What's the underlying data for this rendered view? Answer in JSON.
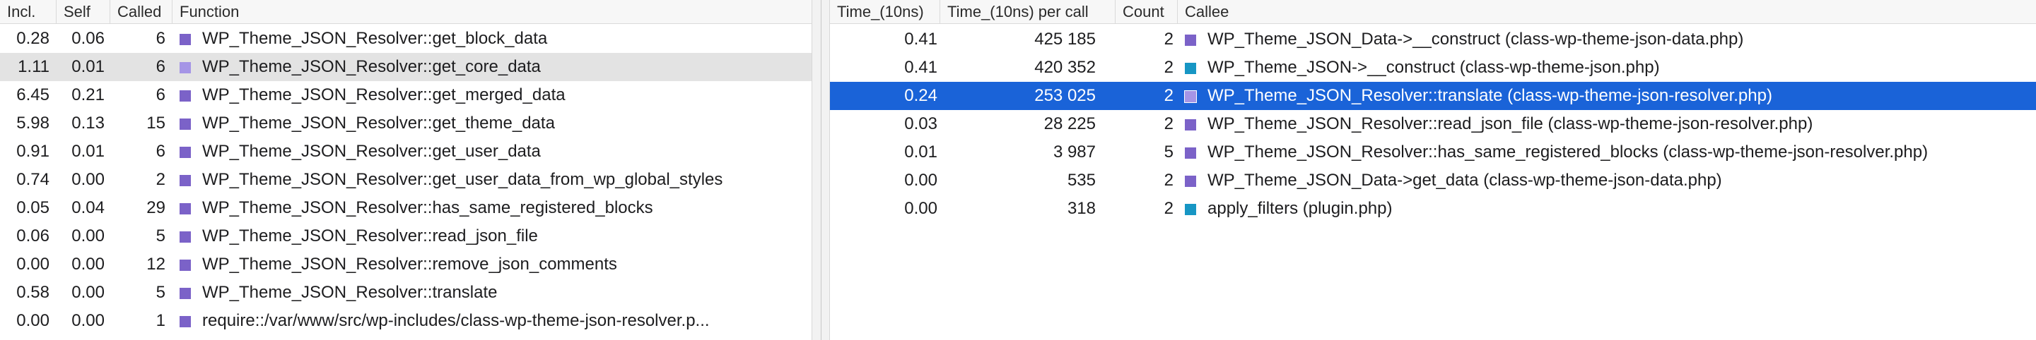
{
  "colors": {
    "purple": "#7b62c8",
    "light_purple": "#a595e6",
    "teal": "#1796c4",
    "selected_row": "#1a63d8",
    "gray_row": "#e3e3e3"
  },
  "left": {
    "headers": {
      "incl": "Incl.",
      "self": "Self",
      "called": "Called",
      "function": "Function"
    },
    "rows": [
      {
        "incl": "0.28",
        "self": "0.06",
        "called": "6",
        "function": "WP_Theme_JSON_Resolver::get_block_data",
        "icon": "purple"
      },
      {
        "incl": "1.11",
        "self": "0.01",
        "called": "6",
        "function": "WP_Theme_JSON_Resolver::get_core_data",
        "icon": "light_purple",
        "highlight": "gray"
      },
      {
        "incl": "6.45",
        "self": "0.21",
        "called": "6",
        "function": "WP_Theme_JSON_Resolver::get_merged_data",
        "icon": "purple"
      },
      {
        "incl": "5.98",
        "self": "0.13",
        "called": "15",
        "function": "WP_Theme_JSON_Resolver::get_theme_data",
        "icon": "purple"
      },
      {
        "incl": "0.91",
        "self": "0.01",
        "called": "6",
        "function": "WP_Theme_JSON_Resolver::get_user_data",
        "icon": "purple"
      },
      {
        "incl": "0.74",
        "self": "0.00",
        "called": "2",
        "function": "WP_Theme_JSON_Resolver::get_user_data_from_wp_global_styles",
        "icon": "purple"
      },
      {
        "incl": "0.05",
        "self": "0.04",
        "called": "29",
        "function": "WP_Theme_JSON_Resolver::has_same_registered_blocks",
        "icon": "purple"
      },
      {
        "incl": "0.06",
        "self": "0.00",
        "called": "5",
        "function": "WP_Theme_JSON_Resolver::read_json_file",
        "icon": "purple"
      },
      {
        "incl": "0.00",
        "self": "0.00",
        "called": "12",
        "function": "WP_Theme_JSON_Resolver::remove_json_comments",
        "icon": "purple"
      },
      {
        "incl": "0.58",
        "self": "0.00",
        "called": "5",
        "function": "WP_Theme_JSON_Resolver::translate",
        "icon": "purple"
      },
      {
        "incl": "0.00",
        "self": "0.00",
        "called": "1",
        "function": "require::/var/www/src/wp-includes/class-wp-theme-json-resolver.p...",
        "icon": "purple"
      }
    ]
  },
  "right": {
    "headers": {
      "time": "Time_(10ns)",
      "per_call": "Time_(10ns) per call",
      "count": "Count",
      "callee": "Callee"
    },
    "rows": [
      {
        "time": "0.41",
        "per_call": "425 185",
        "count": "2",
        "callee": "WP_Theme_JSON_Data->__construct (class-wp-theme-json-data.php)",
        "icon": "purple"
      },
      {
        "time": "0.41",
        "per_call": "420 352",
        "count": "2",
        "callee": "WP_Theme_JSON->__construct (class-wp-theme-json.php)",
        "icon": "teal"
      },
      {
        "time": "0.24",
        "per_call": "253 025",
        "count": "2",
        "callee": "WP_Theme_JSON_Resolver::translate (class-wp-theme-json-resolver.php)",
        "icon": "light_purple",
        "highlight": "blue"
      },
      {
        "time": "0.03",
        "per_call": "28 225",
        "count": "2",
        "callee": "WP_Theme_JSON_Resolver::read_json_file (class-wp-theme-json-resolver.php)",
        "icon": "purple"
      },
      {
        "time": "0.01",
        "per_call": "3 987",
        "count": "5",
        "callee": "WP_Theme_JSON_Resolver::has_same_registered_blocks (class-wp-theme-json-resolver.php)",
        "icon": "purple"
      },
      {
        "time": "0.00",
        "per_call": "535",
        "count": "2",
        "callee": "WP_Theme_JSON_Data->get_data (class-wp-theme-json-data.php)",
        "icon": "purple"
      },
      {
        "time": "0.00",
        "per_call": "318",
        "count": "2",
        "callee": "apply_filters (plugin.php)",
        "icon": "teal"
      }
    ]
  }
}
